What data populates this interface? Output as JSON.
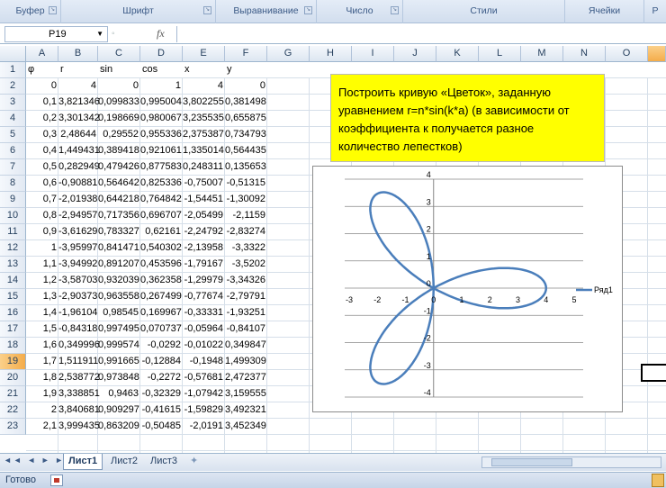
{
  "ribbon": {
    "groups": [
      "Буфер обмена",
      "Шрифт",
      "Выравнивание",
      "Число",
      "Стили",
      "Ячейки",
      "Р"
    ],
    "launcher_icon": "dialog-launcher-icon"
  },
  "formula_bar": {
    "name_box": "P19",
    "fx_label": "fx",
    "formula": ""
  },
  "columns": [
    "A",
    "B",
    "C",
    "D",
    "E",
    "F",
    "G",
    "H",
    "I",
    "J",
    "K",
    "L",
    "M",
    "N",
    "O"
  ],
  "selected_column": "P",
  "rows": [
    "1",
    "2",
    "3",
    "4",
    "5",
    "6",
    "7",
    "8",
    "9",
    "10",
    "11",
    "12",
    "13",
    "14",
    "15",
    "16",
    "17",
    "18",
    "19",
    "20",
    "21",
    "22",
    "23"
  ],
  "selected_row": "19",
  "sheet": {
    "headers": [
      "φ",
      "r",
      "sin",
      "cos",
      "x",
      "y"
    ],
    "data": [
      [
        "0",
        "4",
        "0",
        "1",
        "4",
        "0"
      ],
      [
        "0,1",
        "3,821346",
        "0,099833",
        "0,995004",
        "3,802255",
        "0,381498"
      ],
      [
        "0,2",
        "3,301342",
        "0,198669",
        "0,980067",
        "3,235535",
        "0,655875"
      ],
      [
        "0,3",
        "2,48644",
        "0,29552",
        "0,955336",
        "2,375387",
        "0,734793"
      ],
      [
        "0,4",
        "1,449431",
        "0,389418",
        "0,921061",
        "1,335014",
        "0,564435"
      ],
      [
        "0,5",
        "0,282949",
        "0,479426",
        "0,877583",
        "0,248311",
        "0,135653"
      ],
      [
        "0,6",
        "-0,90881",
        "0,564642",
        "0,825336",
        "-0,75007",
        "-0,51315"
      ],
      [
        "0,7",
        "-2,01938",
        "0,644218",
        "0,764842",
        "-1,54451",
        "-1,30092"
      ],
      [
        "0,8",
        "-2,94957",
        "0,717356",
        "0,696707",
        "-2,05499",
        "-2,1159"
      ],
      [
        "0,9",
        "-3,61629",
        "0,783327",
        "0,62161",
        "-2,24792",
        "-2,83274"
      ],
      [
        "1",
        "-3,95997",
        "0,841471",
        "0,540302",
        "-2,13958",
        "-3,3322"
      ],
      [
        "1,1",
        "-3,94992",
        "0,891207",
        "0,453596",
        "-1,79167",
        "-3,5202"
      ],
      [
        "1,2",
        "-3,58703",
        "0,932039",
        "0,362358",
        "-1,29979",
        "-3,34326"
      ],
      [
        "1,3",
        "-2,90373",
        "0,963558",
        "0,267499",
        "-0,77674",
        "-2,79791"
      ],
      [
        "1,4",
        "-1,96104",
        "0,98545",
        "0,169967",
        "-0,33331",
        "-1,93251"
      ],
      [
        "1,5",
        "-0,84318",
        "0,997495",
        "0,070737",
        "-0,05964",
        "-0,84107"
      ],
      [
        "1,6",
        "0,349996",
        "0,999574",
        "-0,0292",
        "-0,01022",
        "0,349847"
      ],
      [
        "1,7",
        "1,511911",
        "0,991665",
        "-0,12884",
        "-0,1948",
        "1,499309"
      ],
      [
        "1,8",
        "2,538772",
        "0,973848",
        "-0,2272",
        "-0,57681",
        "2,472377"
      ],
      [
        "1,9",
        "3,338851",
        "0,9463",
        "-0,32329",
        "-1,07942",
        "3,159555"
      ],
      [
        "2",
        "3,840681",
        "0,909297",
        "-0,41615",
        "-1,59829",
        "3,492321"
      ],
      [
        "2,1",
        "3,999435",
        "0,863209",
        "-0,50485",
        "-2,0191",
        "3,452349"
      ]
    ]
  },
  "note": {
    "text": "Построить кривую «Цветок», заданную уравнением  r=n*sin(k*a) (в зависимости от коэффициента к получается разное количество лепестков)"
  },
  "chart_data": {
    "type": "scatter",
    "title": "",
    "xlabel": "",
    "ylabel": "",
    "xlim": [
      -3,
      5
    ],
    "ylim": [
      -4,
      4
    ],
    "x_ticks": [
      "-3",
      "-2",
      "-1",
      "0",
      "1",
      "2",
      "3",
      "4",
      "5"
    ],
    "y_ticks": [
      "-4",
      "-3",
      "-2",
      "-1",
      "0",
      "1",
      "2",
      "3",
      "4"
    ],
    "legend": "right",
    "series": [
      {
        "name": "Ряд1",
        "color": "#4a7ebb",
        "curve": "r = 4*sin(3φ + π/2), φ from 0 to π",
        "n": 4,
        "k": 3
      }
    ]
  },
  "tabs": {
    "nav": "◄◄ ◄ ► ►►",
    "sheets": [
      "Лист1",
      "Лист2",
      "Лист3"
    ],
    "active": "Лист1"
  },
  "status": {
    "text": "Готово"
  }
}
